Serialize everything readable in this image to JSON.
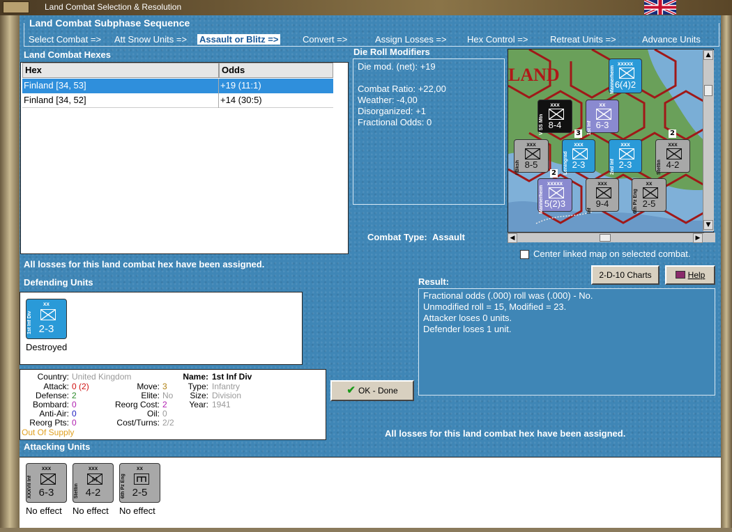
{
  "window": {
    "title": "Land Combat Selection & Resolution"
  },
  "subphase": {
    "title": "Land Combat Subphase Sequence",
    "steps": [
      "Select Combat =>",
      "Att Snow Units =>",
      "Assault or Blitz =>",
      "Convert =>",
      "Assign Losses =>",
      "Hex Control =>",
      "Retreat Units =>",
      "Advance Units"
    ],
    "active_index": 2
  },
  "hexes": {
    "title": "Land Combat Hexes",
    "columns": [
      "Hex",
      "Odds"
    ],
    "rows": [
      {
        "hex": "Finland [34, 53]",
        "odds": "+19 (11:1)",
        "selected": true
      },
      {
        "hex": "Finland [34, 52]",
        "odds": "+14 (30:5)",
        "selected": false
      }
    ]
  },
  "modifiers": {
    "title": "Die Roll Modifiers",
    "lines": [
      "Die mod. (net): +19",
      "",
      "Combat Ratio: +22,00",
      "Weather: -4,00",
      "Disorganized: +1",
      "Fractional Odds: 0"
    ]
  },
  "combat_type": {
    "label": "Combat Type:",
    "value": "Assault"
  },
  "map": {
    "region_label": "LAND",
    "units": [
      {
        "size": "xxxxx",
        "side": "Mannerheim",
        "value": "6(4)2",
        "color": "#2a9ad8"
      },
      {
        "size": "xxx",
        "side": "V SS Mtn",
        "value": "8-4",
        "color": "#111111"
      },
      {
        "size": "xx",
        "side": "1st Inf",
        "value": "6-3",
        "color": "#8a8ad0"
      },
      {
        "size": "xxx",
        "side": "I Bksh",
        "value": "8-5",
        "color": "#a8a8a8"
      },
      {
        "size": "xxx",
        "side": "Leningrad",
        "value": "2-3",
        "color": "#2a9ad8"
      },
      {
        "size": "xxx",
        "side": "2nd Inf",
        "value": "2-3",
        "color": "#2a9ad8"
      },
      {
        "size": "xxx",
        "side": "Stettin",
        "value": "4-2",
        "color": "#a8a8a8"
      },
      {
        "size": "xxxxx",
        "side": "Mannerheim",
        "value": "5(2)3",
        "color": "#8a8ad0"
      },
      {
        "size": "xxx",
        "side": "Inf",
        "value": "9-4",
        "color": "#a8a8a8"
      },
      {
        "size": "xx",
        "side": "6th Pz Eng",
        "value": "2-5",
        "color": "#a8a8a8"
      }
    ],
    "stack_badges": [
      "3",
      "2",
      "2"
    ],
    "center_checkbox_label": "Center linked map on selected combat.",
    "center_checkbox_checked": false
  },
  "losses_notice_top": "All losses for this land combat hex have been assigned.",
  "defending": {
    "title": "Defending Units",
    "units": [
      {
        "size": "xx",
        "side": "1st Inf Div",
        "value": "2-3",
        "status": "Destroyed",
        "color": "#2a9ad8"
      }
    ]
  },
  "buttons": {
    "charts": "2-D-10 Charts",
    "help": "Help",
    "ok": "OK - Done"
  },
  "result": {
    "title": "Result:",
    "lines": [
      "Fractional odds (.000) roll was (.000)  - No.",
      "Unmodified roll = 15, Modified = 23.",
      "Attacker loses 0 units.",
      "Defender loses 1 unit."
    ]
  },
  "unit_info": {
    "country_label": "Country:",
    "country": "United Kingdom",
    "attack_label": "Attack:",
    "attack": "0",
    "attack_extra": "(2)",
    "defense_label": "Defense:",
    "defense": "2",
    "bombard_label": "Bombard:",
    "bombard": "0",
    "antiair_label": "Anti-Air:",
    "antiair": "0",
    "reorg_pts_label": "Reorg Pts:",
    "reorg_pts": "0",
    "supply": "Out Of Supply",
    "move_label": "Move:",
    "move": "3",
    "elite_label": "Elite:",
    "elite": "No",
    "reorg_cost_label": "Reorg Cost:",
    "reorg_cost": "2",
    "oil_label": "Oil:",
    "oil": "0",
    "cost_turns_label": "Cost/Turns:",
    "cost_turns": "2/2",
    "name_label": "Name:",
    "name": "1st Inf Div",
    "type_label": "Type:",
    "type": "Infantry",
    "size_label": "Size:",
    "size": "Division",
    "year_label": "Year:",
    "year": "1941"
  },
  "losses_notice_bottom": "All losses for this land combat hex have been assigned.",
  "attacking": {
    "title": "Attacking Units",
    "units": [
      {
        "size": "xxx",
        "side": "XXXVII Inf",
        "value": "6-3",
        "status": "No effect",
        "icon": "infantry",
        "color": "#a8a8a8"
      },
      {
        "size": "xxx",
        "side": "Stettin",
        "value": "4-2",
        "status": "No effect",
        "icon": "mountain",
        "color": "#a8a8a8"
      },
      {
        "size": "xx",
        "side": "6th Pz Eng",
        "value": "2-5",
        "status": "No effect",
        "icon": "engineer",
        "color": "#a8a8a8"
      }
    ]
  }
}
